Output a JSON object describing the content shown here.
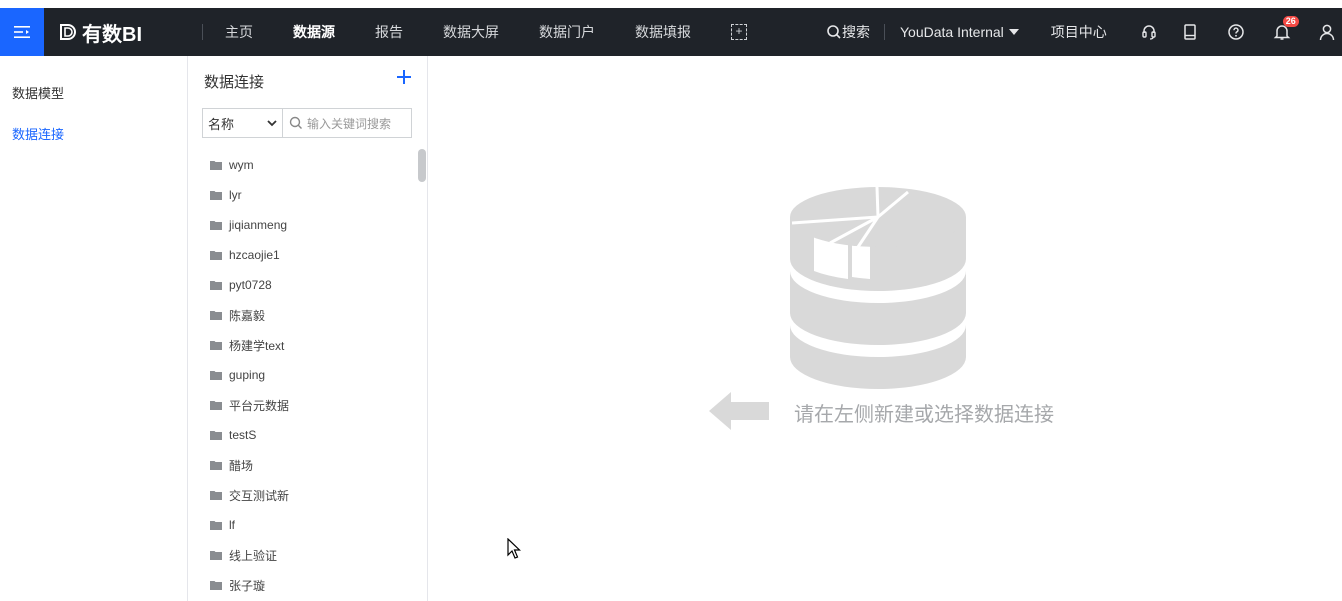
{
  "app": {
    "brand": "有数BI",
    "accent": "#1a66ff",
    "topbar_bg": "#1f2329"
  },
  "nav": {
    "items": [
      "主页",
      "数据源",
      "报告",
      "数据大屏",
      "数据门户",
      "数据填报"
    ],
    "active": "数据源"
  },
  "toolbar": {
    "search_label": "搜索",
    "org_name": "YouData Internal",
    "project_center": "项目中心",
    "notification_count": "26"
  },
  "leftnav": {
    "items": [
      "数据模型",
      "数据连接"
    ],
    "active": "数据连接"
  },
  "panel": {
    "title": "数据连接",
    "filter_select": "名称",
    "search_placeholder": "输入关键词搜索",
    "folders": [
      "wym",
      "lyr",
      "jiqianmeng",
      "hzcaojie1",
      "pyt0728",
      "陈嘉毅",
      "杨建学text",
      "guping",
      "平台元数据",
      "testS",
      "醋场",
      "交互测试新",
      "lf",
      "线上验证",
      "张子璇"
    ]
  },
  "empty_state": {
    "text": "请在左侧新建或选择数据连接"
  }
}
